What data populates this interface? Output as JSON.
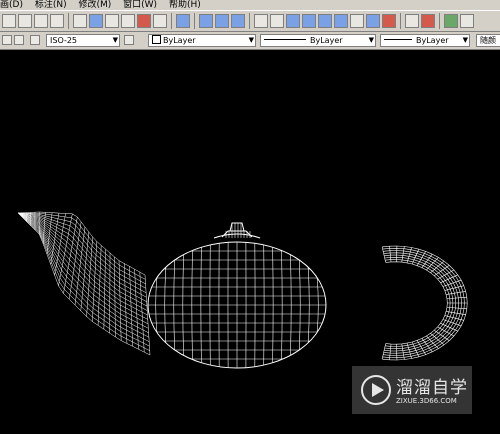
{
  "menu": {
    "items": [
      "画(D)",
      "标注(N)",
      "修改(M)",
      "窗口(W)",
      "帮助(H)"
    ]
  },
  "toolbar": {
    "icons": [
      "pan-icon",
      "zoom-realtime-icon",
      "zoom-window-icon",
      "zoom-previous-icon",
      "properties-icon",
      "design-center-icon",
      "tool-palette-icon",
      "sheet-set-icon",
      "markup-icon",
      "calculator-icon",
      "help-icon",
      "orbit-icon",
      "orbit2-icon",
      "orbit3-icon",
      "box-icon",
      "ucs-icon",
      "view-top-icon",
      "view-front-icon",
      "view-left-icon",
      "view-iso-icon",
      "wireframe-icon",
      "hidden-icon",
      "shade-icon",
      "render-icon",
      "material-icon",
      "light-icon",
      "close-icon"
    ]
  },
  "properties_bar": {
    "dimstyle_value": "ISO-25",
    "layer_value": "ByLayer",
    "linetype_value": "ByLayer",
    "lineweight_value": "ByLayer",
    "plotstyle_value": "随颜"
  },
  "watermark": {
    "title": "溜溜自学",
    "url": "ZIXUE.3D66.COM"
  },
  "colors": {
    "canvas": "#000000",
    "wire": "#ffffff",
    "chrome": "#d4d0c8"
  }
}
